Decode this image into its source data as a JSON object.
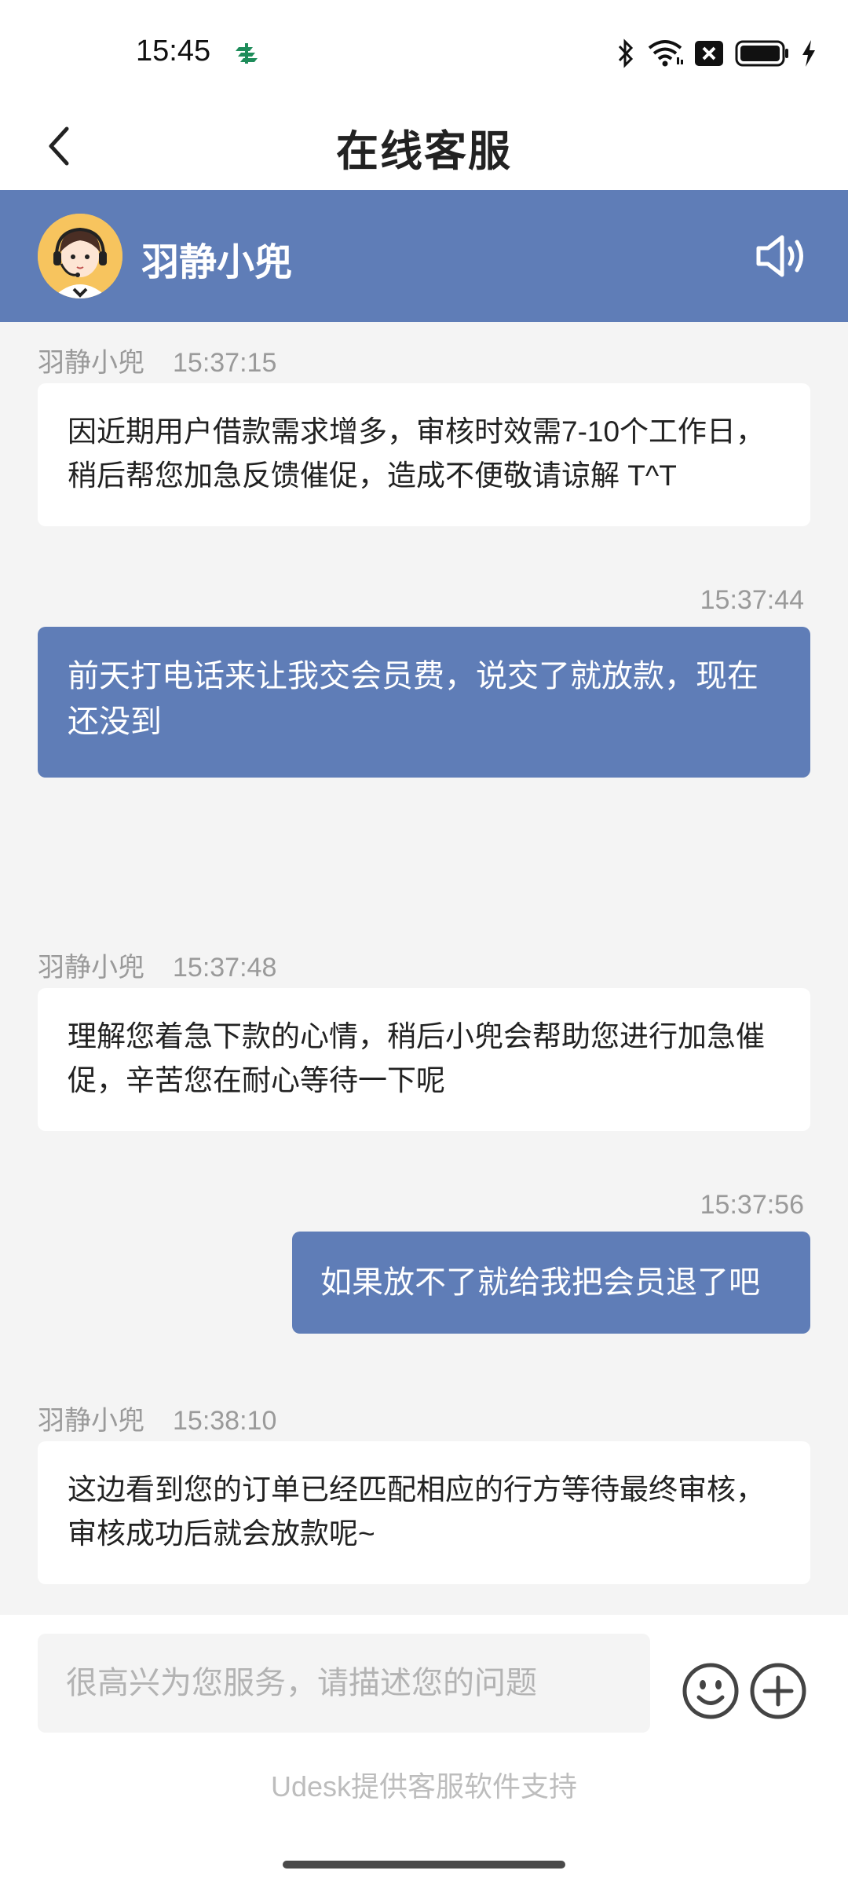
{
  "status_bar": {
    "time": "15:45",
    "icons": [
      "app-notification-icon",
      "bluetooth-icon",
      "wifi-icon",
      "no-sim-icon",
      "battery-icon",
      "charging-icon"
    ]
  },
  "header": {
    "title": "在线客服",
    "back_icon": "chevron-left-icon"
  },
  "agent": {
    "name": "羽静小兜",
    "avatar": "agent-avatar",
    "speaker_icon": "speaker-icon"
  },
  "messages": [
    {
      "sender": "agent",
      "name": "羽静小兜",
      "time": "15:37:15",
      "text": "因近期用户借款需求增多，审核时效需7-10个工作日，稍后帮您加急反馈催促，造成不便敬请谅解 T^T"
    },
    {
      "sender": "user",
      "time": "15:37:44",
      "text": "前天打电话来让我交会员费，说交了就放款，现在还没到"
    },
    {
      "sender": "agent",
      "name": "羽静小兜",
      "time": "15:37:48",
      "text": "理解您着急下款的心情，稍后小兜会帮助您进行加急催促，辛苦您在耐心等待一下呢"
    },
    {
      "sender": "user",
      "time": "15:37:56",
      "text": "如果放不了就给我把会员退了吧"
    },
    {
      "sender": "agent",
      "name": "羽静小兜",
      "time": "15:38:10",
      "text": "这边看到您的订单已经匹配相应的行方等待最终审核，审核成功后就会放款呢~"
    }
  ],
  "input": {
    "placeholder": "很高兴为您服务，请描述您的问题",
    "value": "",
    "emoji_icon": "emoji-icon",
    "plus_icon": "plus-circle-icon"
  },
  "footer": {
    "powered_by": "Udesk提供客服软件支持"
  },
  "colors": {
    "brand": "#5f7db7",
    "background": "#f4f4f4",
    "bubble_agent": "#ffffff",
    "meta_text": "#9a9a9a"
  }
}
